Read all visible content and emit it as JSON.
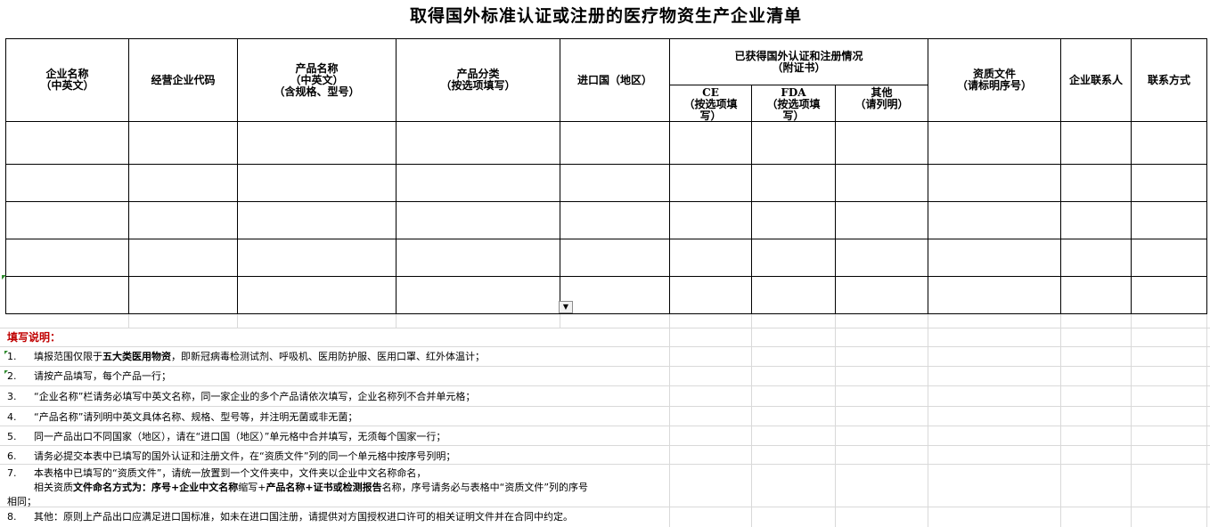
{
  "title": "取得国外标准认证或注册的医疗物资生产企业清单",
  "headers": {
    "company_name": [
      "企业名称",
      "（中英文）"
    ],
    "company_code": "经营企业代码",
    "product_name": [
      "产品名称",
      "（中英文）",
      "（含规格、型号）"
    ],
    "product_category": [
      "产品分类",
      "（按选项填写）"
    ],
    "import_country": "进口国（地区）",
    "cert_group": [
      "已获得国外认证和注册情况",
      "（附证书）"
    ],
    "ce": [
      "CE",
      "（按选项填",
      "写）"
    ],
    "fda": [
      "FDA",
      "（按选项填",
      "写）"
    ],
    "other": [
      "其他",
      "（请列明）"
    ],
    "qualification": [
      "资质文件",
      "（请标明序号）"
    ],
    "contact_person": "企业联系人",
    "contact_method": "联系方式"
  },
  "dropdown_icon": "chevron-down-icon",
  "notes": {
    "title": "填写说明：",
    "items": [
      {
        "num": "1.",
        "pre": "填报范围仅限于",
        "bold": "五大类医用物资",
        "post": "，即新冠病毒检测试剂、呼吸机、医用防护服、医用口罩、红外体温计；"
      },
      {
        "num": "2.",
        "text": "请按产品填写，每个产品一行；"
      },
      {
        "num": "3.",
        "text": "“企业名称”栏请务必填写中英文名称，同一家企业的多个产品请依次填写，企业名称列不合并单元格；"
      },
      {
        "num": "4.",
        "text": "“产品名称”请列明中英文具体名称、规格、型号等，并注明无菌或非无菌；"
      },
      {
        "num": "5.",
        "text": "同一产品出口不同国家（地区），请在“进口国（地区）”单元格中合并填写，无须每个国家一行；"
      },
      {
        "num": "6.",
        "text": "请务必提交本表中已填写的国外认证和注册文件，在“资质文件”列的同一个单元格中按序号列明；"
      },
      {
        "num": "7.",
        "text": "本表格中已填写的“资质文件”，请统一放置到一个文件夹中，文件夹以企业中文名称命名，"
      },
      {
        "line_a": "相关资质",
        "bold_a": "文件命名方式为：序号+企业中文名称",
        "line_b": "缩写+",
        "bold_b": "产品名称+证书或检测报告",
        "line_c": "名称，序号请务必与表格中“资质文件”列的序号"
      },
      {
        "text": "相同；"
      },
      {
        "num": "8.",
        "text": "其他：原则上产品出口应满足进口国标准，如未在进口国注册，请提供对方国授权进口许可的相关证明文件并在合同中约定。"
      }
    ]
  }
}
